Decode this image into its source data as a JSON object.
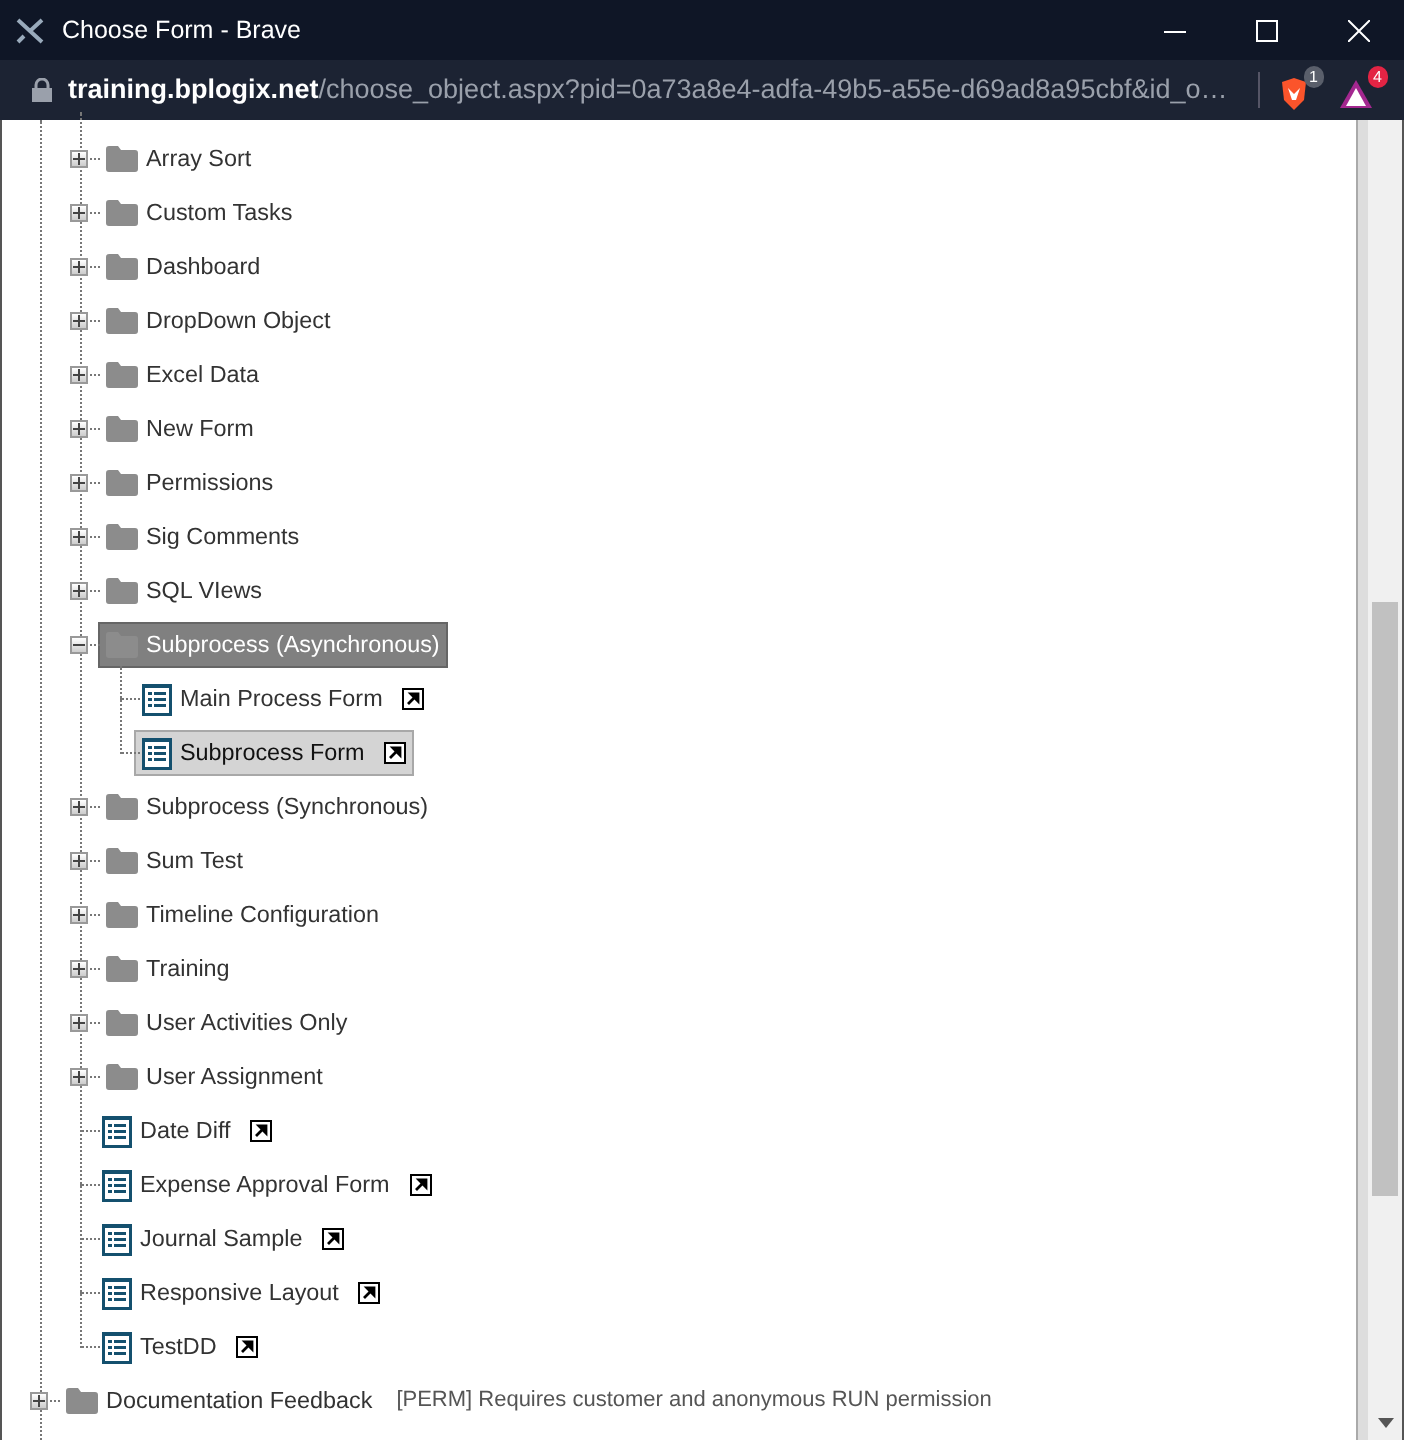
{
  "window": {
    "title": "Choose Form - Brave"
  },
  "address_bar": {
    "host": "training.bplogix.net",
    "path": "/choose_object.aspx?pid=0a73a8e4-adfa-49b5-a55e-d69ad8a95cbf&id_o…",
    "shields_badge": "1",
    "rewards_badge": "4"
  },
  "tree": {
    "open_branch": [
      {
        "label": "Array Sort",
        "kind": "folder",
        "expanded": false,
        "selected": false
      },
      {
        "label": "Custom Tasks",
        "kind": "folder",
        "expanded": false,
        "selected": false
      },
      {
        "label": "Dashboard",
        "kind": "folder",
        "expanded": false,
        "selected": false
      },
      {
        "label": "DropDown Object",
        "kind": "folder",
        "expanded": false,
        "selected": false
      },
      {
        "label": "Excel Data",
        "kind": "folder",
        "expanded": false,
        "selected": false
      },
      {
        "label": "New Form",
        "kind": "folder",
        "expanded": false,
        "selected": false
      },
      {
        "label": "Permissions",
        "kind": "folder",
        "expanded": false,
        "selected": false
      },
      {
        "label": "Sig Comments",
        "kind": "folder",
        "expanded": false,
        "selected": false
      },
      {
        "label": "SQL VIews",
        "kind": "folder",
        "expanded": false,
        "selected": false
      },
      {
        "label": "Subprocess (Asynchronous)",
        "kind": "folder",
        "expanded": true,
        "selected": true,
        "children": [
          {
            "label": "Main Process Form",
            "kind": "form",
            "selected": false
          },
          {
            "label": "Subprocess Form",
            "kind": "form",
            "selected": true
          }
        ]
      },
      {
        "label": "Subprocess (Synchronous)",
        "kind": "folder",
        "expanded": false,
        "selected": false
      },
      {
        "label": "Sum Test",
        "kind": "folder",
        "expanded": false,
        "selected": false
      },
      {
        "label": "Timeline Configuration",
        "kind": "folder",
        "expanded": false,
        "selected": false
      },
      {
        "label": "Training",
        "kind": "folder",
        "expanded": false,
        "selected": false
      },
      {
        "label": "User Activities Only",
        "kind": "folder",
        "expanded": false,
        "selected": false
      },
      {
        "label": "User Assignment",
        "kind": "folder",
        "expanded": false,
        "selected": false
      },
      {
        "label": "Date Diff",
        "kind": "form",
        "selected": false
      },
      {
        "label": "Expense Approval Form",
        "kind": "form",
        "selected": false
      },
      {
        "label": "Journal Sample",
        "kind": "form",
        "selected": false
      },
      {
        "label": "Responsive Layout",
        "kind": "form",
        "selected": false
      },
      {
        "label": "TestDD",
        "kind": "form",
        "selected": false
      }
    ],
    "root_items": [
      {
        "label": "Documentation Feedback",
        "kind": "folder",
        "expanded": false,
        "selected": false,
        "note": "[PERM] Requires customer and anonymous RUN permission"
      }
    ]
  }
}
